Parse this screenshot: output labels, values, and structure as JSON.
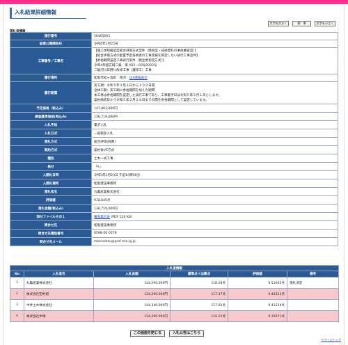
{
  "title": "入札結果詳細情報",
  "font_buttons": [
    "文字を大きく",
    "標　準",
    "文字を小さく"
  ],
  "section_label": "落札者情報",
  "details": [
    {
      "label": "施行番号",
      "value": "50405001"
    },
    {
      "label": "結果公開開始日",
      "value": "令和6年1月25日"
    },
    {
      "label": "工事番号／工事名",
      "lines": [
        "【施工体制確認型総合評価方式案件（簡易型・技術資料の事後審査型）】",
        "【総合評価方式の配置予定技術者の工事実績を限定しない試行工事案件】",
        "【余裕期間設定工事試行案件（発注者指定方式）】",
        "令和4年度広域二級　第 A55－00号0002号",
        "二級河川日野川改修工事（護岸工）工事"
      ]
    },
    {
      "label": "履行場所",
      "value": "松阪市松ヶ島町　地内",
      "link": "GIS情報表示"
    },
    {
      "label": "履行期間",
      "lines": [
        "実工期：令和５年３月１日から３００日間",
        "全体工期：実工期に余裕期間を加えた期間",
        "本工事は余裕期間を設定した試行工事であり、工事着手日は令和５年３月１日とします。",
        "契約締結日から令和５年２月２８日までの間を余裕期間として設定しています。"
      ]
    },
    {
      "label": "予定価格（税込み）",
      "value": "147,862,000円"
    },
    {
      "label": "調査基準価格(税込み)",
      "value": "136,719,000円"
    },
    {
      "label": "入札手段",
      "value": "電子入札"
    },
    {
      "label": "入札方式",
      "value": "一般競争入札"
    },
    {
      "label": "落札方式",
      "value": "総合評価(除算)"
    },
    {
      "label": "契約方式",
      "value": "契約後VE方式"
    },
    {
      "label": "種別",
      "value": "土木一式工事"
    },
    {
      "label": "格付",
      "value": "「A」"
    },
    {
      "label": "入開札日時",
      "value": "令和5年1月23日 午前10時00分"
    },
    {
      "label": "入開札場所",
      "value": "松阪建設事務所"
    },
    {
      "label": "落札者名",
      "value": "丸亀産業株式会社"
    },
    {
      "label": "評価値",
      "value": "9.51645点"
    },
    {
      "label": "落札金額(税込み)",
      "value": "136,719,000円"
    },
    {
      "label": "添付ファイルその１",
      "link": "審査集計表",
      "suffix": "(PDF 126 KB)"
    },
    {
      "label": "問合せ先",
      "value": "松阪建設事務所"
    },
    {
      "label": "問合せ先電話番号",
      "value": "0598-50-0578"
    },
    {
      "label": "問合せ先メール",
      "value": "mkensetsu@pref.mie.lg.jp"
    }
  ],
  "bid_caption": "入札者情報",
  "bid_headers": [
    "No",
    "入札者名",
    "入札金額",
    "標準点＋加算点",
    "評価値",
    "備考"
  ],
  "bids": [
    {
      "no": "1",
      "name": "丸亀産業株式会社",
      "amount": "124,290,000円",
      "score": "118.28点",
      "eval": "9.51645点",
      "note": "落札決定"
    },
    {
      "no": "2",
      "name": "株式会社田村組",
      "amount": "124,290,000円",
      "score": "117.37点",
      "eval": "9.44323点",
      "note": ""
    },
    {
      "no": "3",
      "name": "中井土木株式会社",
      "amount": "124,340,000円",
      "score": "117.02点",
      "eval": "9.41129点",
      "note": ""
    },
    {
      "no": "4",
      "name": "株式会社中塚",
      "amount": "124,290,000円",
      "score": "116.22点",
      "eval": "9.35071点",
      "note": ""
    }
  ],
  "close_button": "この画面を閉じる",
  "notice_button": "入札公告はこちら",
  "page_top": "<ページトップ"
}
